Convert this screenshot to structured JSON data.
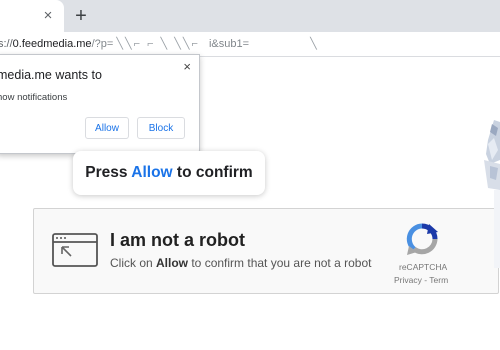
{
  "browser": {
    "new_tab_label": "+",
    "tab_close": "×",
    "url": {
      "protocol": "s://",
      "host": "0.feedmedia.me",
      "rest": "/?p=",
      "junk": "╲╲⌐ ⌐ ╲ ╲╲⌐",
      "rest2": "i&sub1=",
      "junk2": "╲"
    }
  },
  "permission_popup": {
    "title": "media.me wants to",
    "description": "how notifications",
    "allow_label": "Allow",
    "block_label": "Block",
    "close_label": "×"
  },
  "prompt_card": {
    "before": "Press ",
    "accent": "Allow",
    "after": " to confirm"
  },
  "captcha": {
    "title": "I am not a robot",
    "sub_before": "Click on ",
    "sub_bold": "Allow",
    "sub_after": " to confirm that you are not a robot",
    "brand": "reCAPTCHA",
    "privacy": "Privacy",
    "separator": " - ",
    "terms": "Term"
  },
  "colors": {
    "accent": "#1a73e8",
    "recaptcha_blue": "#4a90e2",
    "recaptcha_grey": "#a6a6a6"
  }
}
